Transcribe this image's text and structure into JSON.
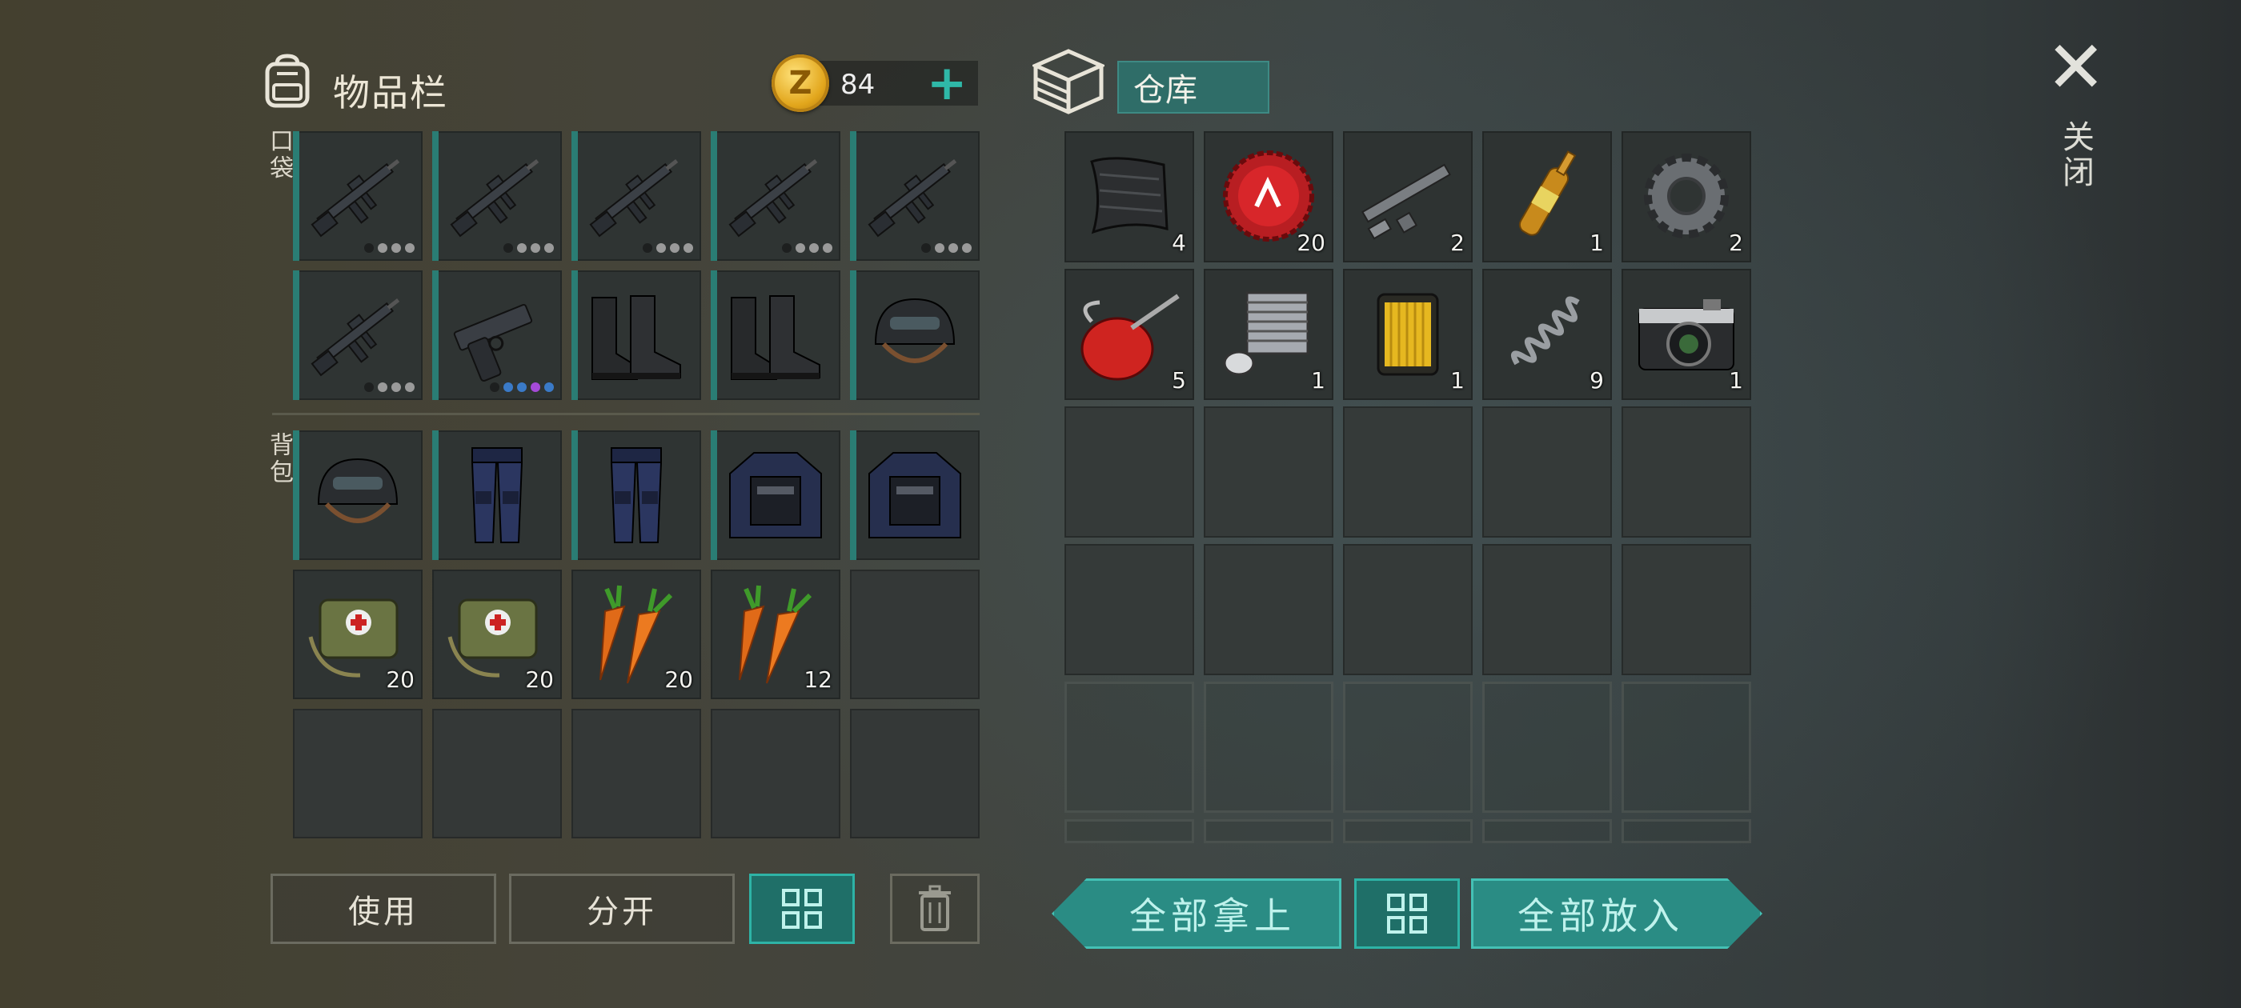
{
  "inventory": {
    "title": "物品栏",
    "coins": "84",
    "coin_symbol": "Z",
    "add_symbol": "+",
    "pocket_label": "口袋",
    "backpack_label": "背包",
    "pocket_slots": [
      {
        "item": "assault-rifle",
        "dots": [
          "dark",
          "gray",
          "gray",
          "gray"
        ]
      },
      {
        "item": "assault-rifle",
        "dots": [
          "dark",
          "gray",
          "gray",
          "gray"
        ]
      },
      {
        "item": "assault-rifle",
        "dots": [
          "dark",
          "gray",
          "gray",
          "gray"
        ]
      },
      {
        "item": "assault-rifle",
        "dots": [
          "dark",
          "gray",
          "gray",
          "gray"
        ]
      },
      {
        "item": "assault-rifle",
        "dots": [
          "dark",
          "gray",
          "gray",
          "gray"
        ]
      },
      {
        "item": "assault-rifle",
        "dots": [
          "dark",
          "gray",
          "gray",
          "gray"
        ]
      },
      {
        "item": "pistol",
        "dots": [
          "dark",
          "blue",
          "blue",
          "purple",
          "blue"
        ]
      },
      {
        "item": "combat-boots"
      },
      {
        "item": "combat-boots"
      },
      {
        "item": "police-helmet"
      }
    ],
    "backpack_slots": [
      {
        "item": "police-helmet"
      },
      {
        "item": "police-pants"
      },
      {
        "item": "police-pants"
      },
      {
        "item": "police-vest"
      },
      {
        "item": "police-vest"
      },
      {
        "item": "medkit-bag",
        "qty": "20"
      },
      {
        "item": "medkit-bag",
        "qty": "20"
      },
      {
        "item": "carrots",
        "qty": "20"
      },
      {
        "item": "carrots",
        "qty": "12"
      },
      {
        "item": ""
      },
      {
        "item": ""
      },
      {
        "item": ""
      },
      {
        "item": ""
      },
      {
        "item": ""
      },
      {
        "item": ""
      }
    ],
    "buttons": {
      "use": "使用",
      "split": "分开"
    }
  },
  "storage": {
    "title": "仓库",
    "slots": [
      {
        "item": "carbon-fiber",
        "qty": "4"
      },
      {
        "item": "bottle-cap",
        "qty": "20"
      },
      {
        "item": "gun-parts",
        "qty": "2"
      },
      {
        "item": "ampoule",
        "qty": "1"
      },
      {
        "item": "gear",
        "qty": "2"
      },
      {
        "item": "oil-can",
        "qty": "5"
      },
      {
        "item": "engine-cylinder",
        "qty": "1"
      },
      {
        "item": "oil-filter",
        "qty": "1"
      },
      {
        "item": "spring",
        "qty": "9"
      },
      {
        "item": "camera",
        "qty": "1"
      }
    ],
    "buttons": {
      "take_all": "全部拿上",
      "put_all": "全部放入"
    }
  },
  "close": {
    "label": "关闭",
    "symbol": "✕"
  },
  "colors": {
    "accent": "#2fb8a8",
    "equip_marker": "#2a7d74",
    "storage_tab": "#2f6d68"
  }
}
